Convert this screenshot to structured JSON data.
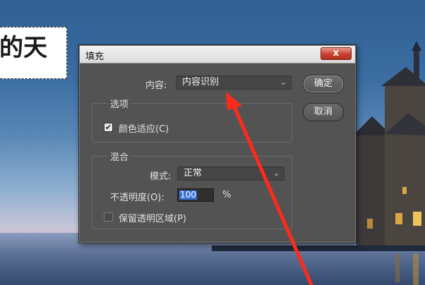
{
  "background": {
    "marquee_text": "的天"
  },
  "dialog": {
    "title": "填充",
    "close_label": "x",
    "contents_label": "内容:",
    "contents_value": "内容识别",
    "options_group_title": "选项",
    "color_adaptation_label": "颜色适应(C)",
    "color_adaptation_checked": true,
    "check_mark": "✔",
    "blending_group_title": "混合",
    "mode_label": "模式:",
    "mode_value": "正常",
    "opacity_label": "不透明度(O):",
    "opacity_value": "100",
    "opacity_unit": "%",
    "preserve_transparency_label": "保留透明区域(P)",
    "preserve_transparency_checked": false,
    "ok_label": "确定",
    "cancel_label": "取消",
    "chevron": "⌄"
  },
  "colors": {
    "dialog_bg": "#535353",
    "annotation_arrow": "#ff2a1a",
    "close_button": "#c8402e",
    "selection_highlight": "#3874d8"
  }
}
